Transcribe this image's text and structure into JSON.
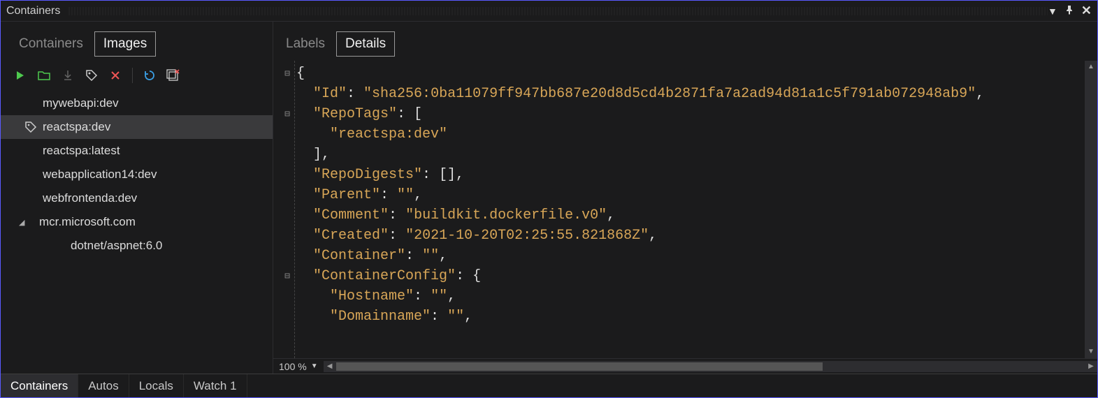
{
  "panel": {
    "title": "Containers"
  },
  "left": {
    "tabs": {
      "containers": "Containers",
      "images": "Images",
      "active": "images"
    },
    "tree": {
      "items": [
        {
          "label": "mywebapi:dev",
          "tagged": false,
          "selected": false
        },
        {
          "label": "reactspa:dev",
          "tagged": true,
          "selected": true
        },
        {
          "label": "reactspa:latest",
          "tagged": false,
          "selected": false
        },
        {
          "label": "webapplication14:dev",
          "tagged": false,
          "selected": false
        },
        {
          "label": "webfrontenda:dev",
          "tagged": false,
          "selected": false
        }
      ],
      "group": {
        "label": "mcr.microsoft.com",
        "expanded": true,
        "children": [
          {
            "label": "dotnet/aspnet:6.0"
          }
        ]
      }
    }
  },
  "right": {
    "tabs": {
      "labels": "Labels",
      "details": "Details",
      "active": "details"
    },
    "zoom": "100 %",
    "json": {
      "Id": "sha256:0ba11079ff947bb687e20d8d5cd4b2871fa7a2ad94d81a1c5f791ab072948ab9",
      "RepoTags": [
        "reactspa:dev"
      ],
      "RepoDigests": [],
      "Parent": "",
      "Comment": "buildkit.dockerfile.v0",
      "Created": "2021-10-20T02:25:55.821868Z",
      "Container": "",
      "ContainerConfig": {
        "Hostname": "",
        "Domainname": ""
      }
    }
  },
  "bottom": {
    "tabs": [
      "Containers",
      "Autos",
      "Locals",
      "Watch 1"
    ],
    "active": 0
  },
  "colors": {
    "accent": "#d8a657",
    "bg": "#1b1b1c"
  }
}
